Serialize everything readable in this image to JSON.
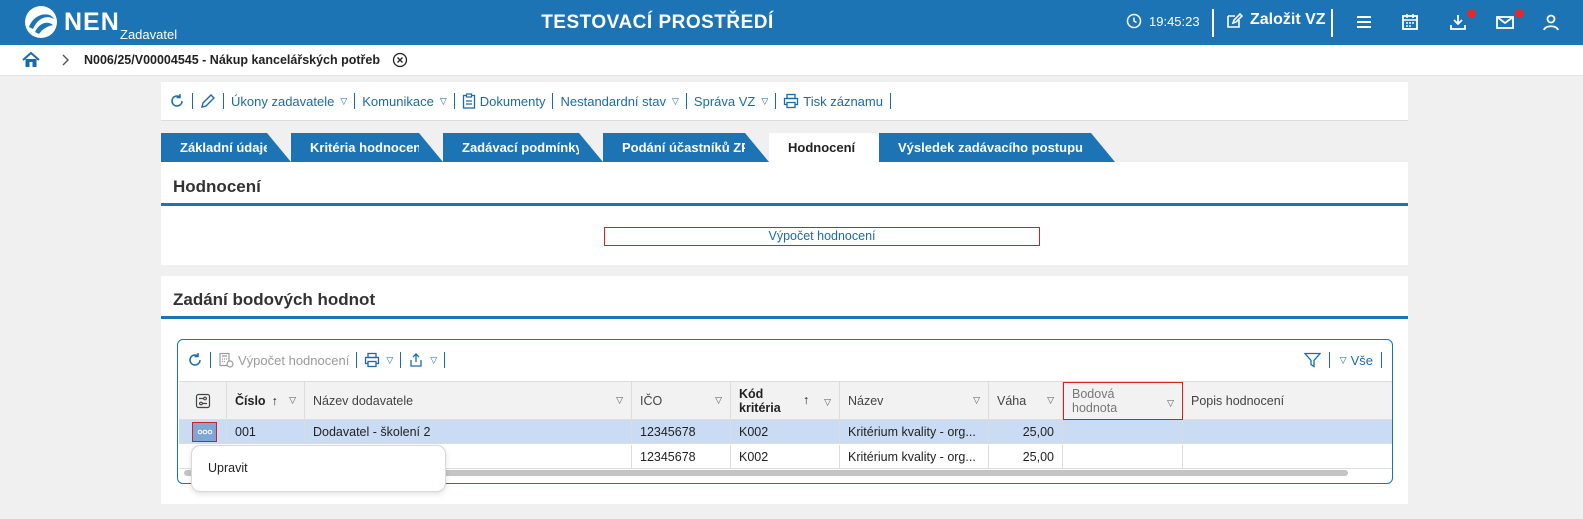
{
  "header": {
    "logo_text": "NEN",
    "logo_sub": "Zadavatel",
    "environment_title": "TESTOVACÍ PROSTŘEDÍ",
    "clock_time": "19:45:23",
    "create_label": "Založit VZ"
  },
  "breadcrumb": {
    "current": "N006/25/V00004545 - Nákup kancelářských potřeb"
  },
  "actions": {
    "ukony": "Úkony zadavatele",
    "komunikace": "Komunikace",
    "dokumenty": "Dokumenty",
    "nestandardni": "Nestandardní stav",
    "sprava": "Správa VZ",
    "tisk": "Tisk záznamu"
  },
  "tabs": [
    {
      "label": "Základní údaje"
    },
    {
      "label": "Kritéria hodnocení"
    },
    {
      "label": "Zadávací podmínky"
    },
    {
      "label": "Podání účastníků ZP"
    },
    {
      "label": "Hodnocení"
    },
    {
      "label": "Výsledek zadávacího postupu"
    }
  ],
  "evaluation_panel": {
    "title": "Hodnocení",
    "calc_button": "Výpočet hodnocení"
  },
  "points_panel": {
    "title": "Zadání bodových hodnot",
    "toolbar": {
      "calc_label": "Výpočet hodnocení",
      "filter_all": "Vše"
    },
    "columns": {
      "cislo": "Číslo",
      "nazev_dodavatele": "Název dodavatele",
      "ico": "IČO",
      "kod_kriteria_1": "Kód",
      "kod_kriteria_2": "kritéria",
      "nazev": "Název",
      "vaha": "Váha",
      "bodova_1": "Bodová",
      "bodova_2": "hodnota",
      "popis": "Popis hodnocení"
    },
    "rows": [
      {
        "cislo": "001",
        "dodavatel": "Dodavatel - školení 2",
        "ico": "12345678",
        "kod": "K002",
        "nazev": "Kritérium kvality - org...",
        "vaha": "25,00",
        "bodova": "",
        "popis": ""
      },
      {
        "cislo": "",
        "dodavatel": "",
        "ico": "12345678",
        "kod": "K002",
        "nazev": "Kritérium kvality - org...",
        "vaha": "25,00",
        "bodova": "",
        "popis": ""
      }
    ]
  },
  "context_menu": {
    "item": "Upravit"
  },
  "colors": {
    "brand": "#1c74b4",
    "highlight_border": "#d61f1f",
    "selected_row": "#c9dcf4",
    "badge": "#e12b2b"
  }
}
